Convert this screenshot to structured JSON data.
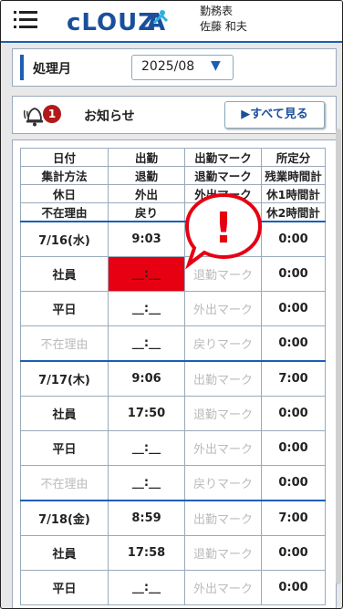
{
  "app": {
    "logo_text": "cLOUZA",
    "title_line1": "勤務表",
    "title_line2": "佐藤 和夫"
  },
  "period": {
    "label": "処理月",
    "value": "2025/08"
  },
  "notice": {
    "count": "1",
    "label": "お知らせ",
    "see_all": "▶すべて見る"
  },
  "table": {
    "headers": [
      [
        "日付",
        "出勤",
        "出勤マーク",
        "所定分"
      ],
      [
        "集計方法",
        "退勤",
        "退勤マーク",
        "残業時間計"
      ],
      [
        "休日",
        "外出",
        "外出マーク",
        "休1時間計"
      ],
      [
        "不在理由",
        "戻り",
        "戻りマーク",
        "休2時間計"
      ]
    ],
    "days": [
      {
        "rows": [
          [
            "7/16(水)",
            "9:03",
            "",
            "0:00"
          ],
          [
            "社員",
            "__:__",
            "退勤マーク",
            "0:00"
          ],
          [
            "平日",
            "__:__",
            "外出マーク",
            "0:00"
          ],
          [
            "不在理由",
            "__:__",
            "戻りマーク",
            "0:00"
          ]
        ]
      },
      {
        "rows": [
          [
            "7/17(木)",
            "9:06",
            "出勤マーク",
            "7:00"
          ],
          [
            "社員",
            "17:50",
            "退勤マーク",
            "0:00"
          ],
          [
            "平日",
            "__:__",
            "外出マーク",
            "0:00"
          ],
          [
            "不在理由",
            "__:__",
            "戻りマーク",
            "0:00"
          ]
        ]
      },
      {
        "rows": [
          [
            "7/18(金)",
            "8:59",
            "出勤マーク",
            "7:00"
          ],
          [
            "社員",
            "17:58",
            "退勤マーク",
            "0:00"
          ],
          [
            "平日",
            "__:__",
            "外出マーク",
            "0:00"
          ]
        ]
      }
    ]
  },
  "alert": {
    "symbol": "!"
  },
  "colors": {
    "accent": "#1a5fb4",
    "error": "#e60012",
    "badge": "#b11a1a"
  }
}
